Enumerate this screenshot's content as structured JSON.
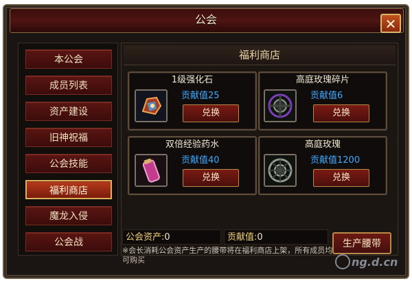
{
  "window": {
    "title": "公会",
    "close_glyph": "✕"
  },
  "sidebar": {
    "items": [
      {
        "label": "本公会",
        "active": false
      },
      {
        "label": "成员列表",
        "active": false
      },
      {
        "label": "资产建设",
        "active": false
      },
      {
        "label": "旧神祝福",
        "active": false
      },
      {
        "label": "公会技能",
        "active": false
      },
      {
        "label": "福利商店",
        "active": true
      },
      {
        "label": "魔龙入侵",
        "active": false
      },
      {
        "label": "公会战",
        "active": false
      }
    ]
  },
  "shop": {
    "title": "福利商店",
    "items": [
      {
        "name": "1级强化石",
        "cost": "贡献值25",
        "button": "兑换",
        "icon": "enhance-stone-icon"
      },
      {
        "name": "高庭玫瑰碎片",
        "cost": "贡献值6",
        "button": "兑换",
        "icon": "rose-fragment-icon"
      },
      {
        "name": "双倍经验药水",
        "cost": "贡献值40",
        "button": "兑换",
        "icon": "exp-potion-icon"
      },
      {
        "name": "高庭玫瑰",
        "cost": "贡献值1200",
        "button": "兑换",
        "icon": "rose-icon"
      }
    ]
  },
  "footer": {
    "assets_label": "公会资产:",
    "assets_value": "0",
    "contribution_label": "贡献值:",
    "contribution_value": "0",
    "produce_button": "生产腰带",
    "note": "※会长消耗公会资产生产的腰带将在福利商店上架，所有成员均可购买"
  },
  "watermark": {
    "text": "ng.d.cn"
  },
  "colors": {
    "accent": "#e0b05a",
    "cost": "#3fa9ff",
    "panel": "#1a1412"
  }
}
